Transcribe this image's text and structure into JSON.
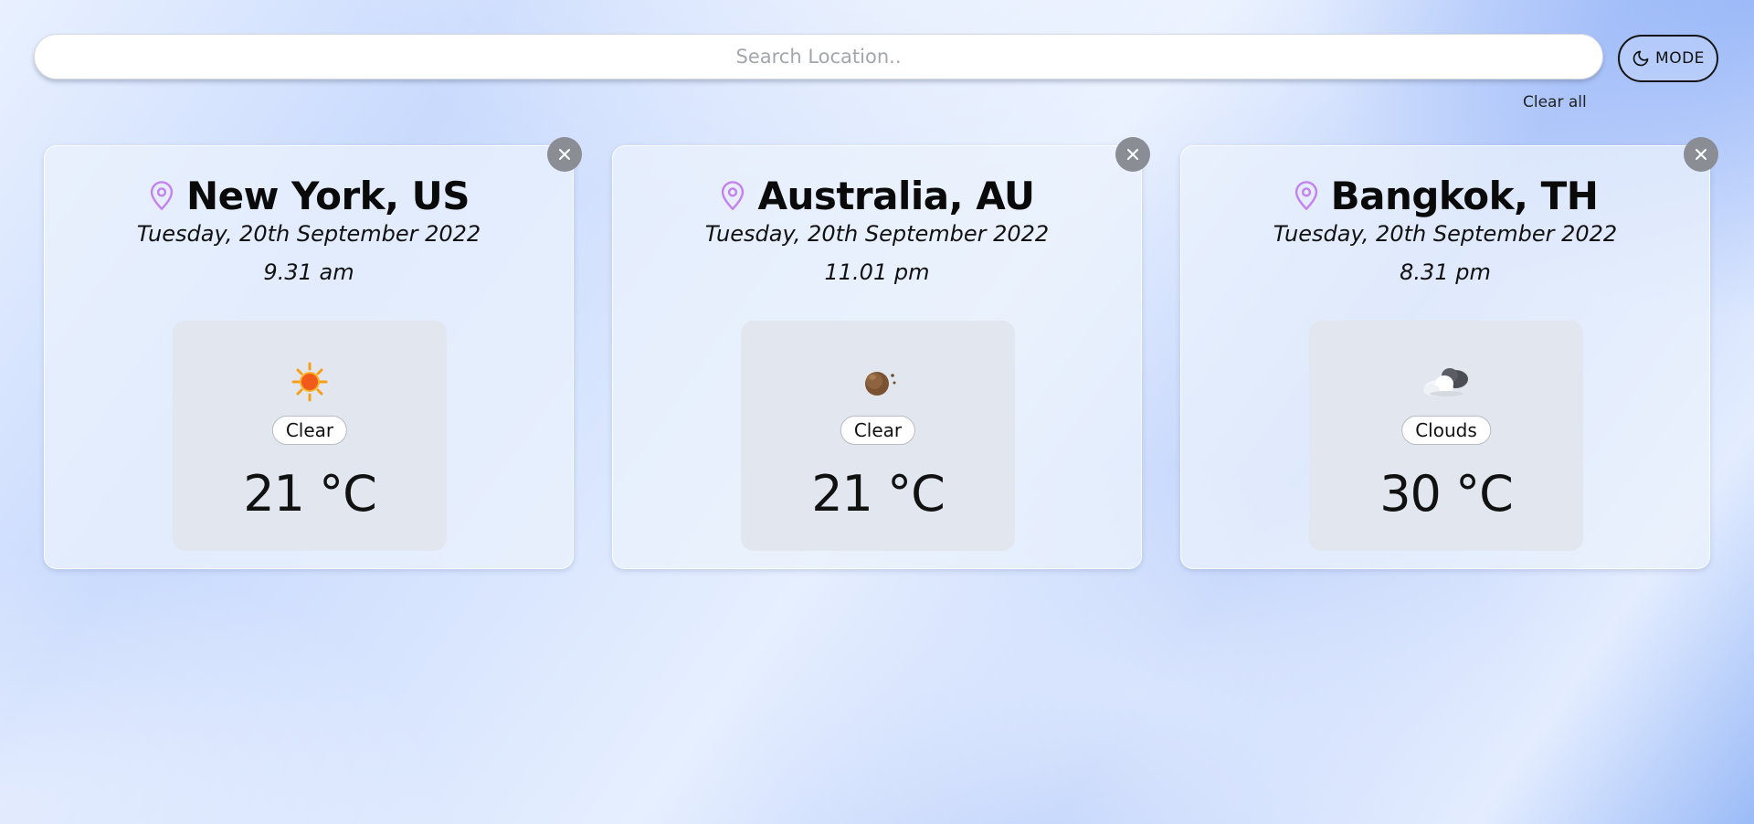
{
  "search": {
    "placeholder": "Search Location.."
  },
  "mode_button": {
    "label": "MODE",
    "icon": "moon-icon"
  },
  "clear_all": "Clear all",
  "colors": {
    "pin": "#c481f0",
    "close_button": "#8a8d93",
    "mode_border": "#141414"
  },
  "cards": [
    {
      "city": "New York, US",
      "date": "Tuesday, 20th September 2022",
      "time": "9.31 am",
      "condition": "Clear",
      "temperature": "21 °C",
      "icon": "sun-icon"
    },
    {
      "city": "Australia, AU",
      "date": "Tuesday, 20th September 2022",
      "time": "11.01 pm",
      "condition": "Clear",
      "temperature": "21 °C",
      "icon": "moon-night-icon"
    },
    {
      "city": "Bangkok, TH",
      "date": "Tuesday, 20th September 2022",
      "time": "8.31 pm",
      "condition": "Clouds",
      "temperature": "30 °C",
      "icon": "cloud-night-icon"
    }
  ]
}
